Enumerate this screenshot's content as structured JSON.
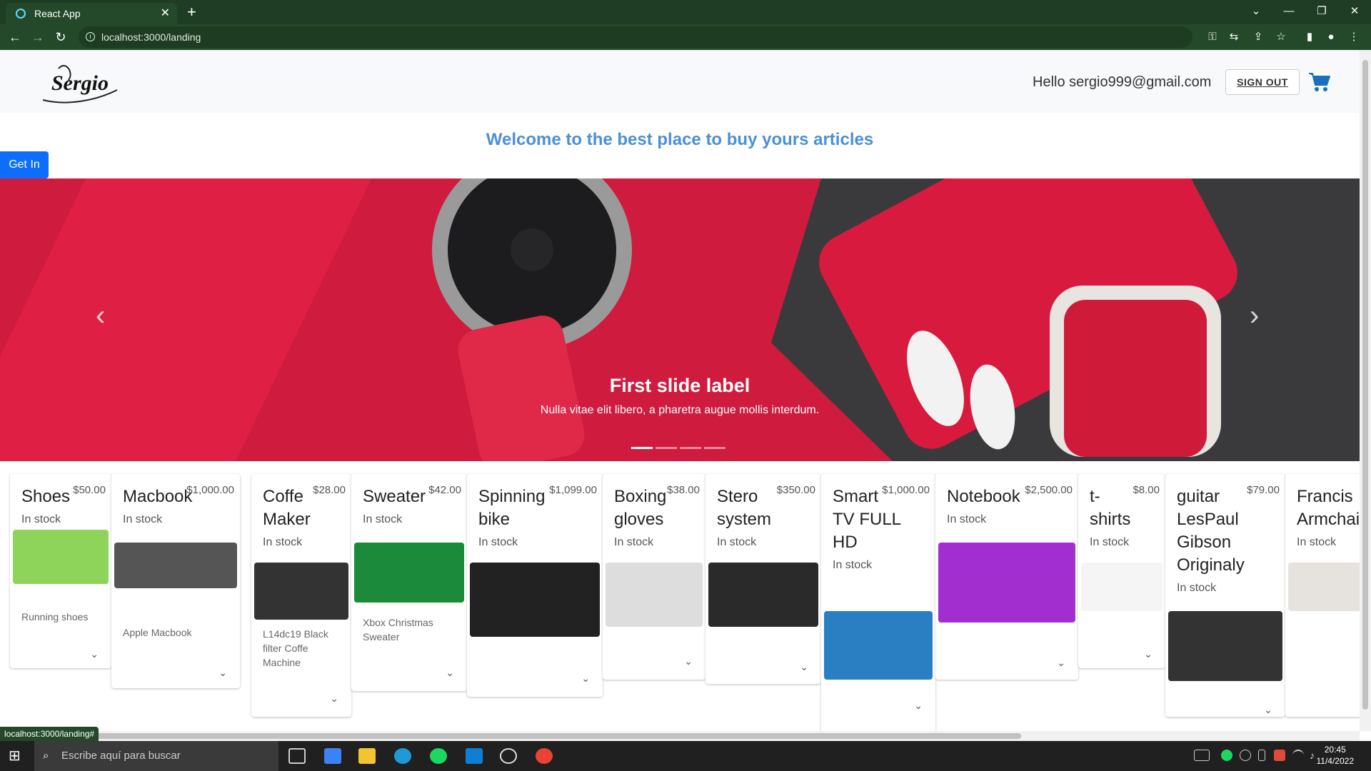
{
  "browser": {
    "tab_title": "React App",
    "tab_close": "✕",
    "new_tab": "+",
    "url": "localhost:3000/landing",
    "status_url": "localhost:3000/landing#"
  },
  "header": {
    "logo_text": "Sergio",
    "greeting": "Hello sergio999@gmail.com",
    "sign_out": "SIGN OUT"
  },
  "welcome": "Welcome to the best place to buy yours articles",
  "get_in": "Get In",
  "carousel": {
    "caption_title": "First slide label",
    "caption_text": "Nulla vitae elit libero, a pharetra augue mollis interdum.",
    "prev": "‹",
    "next": "›",
    "indicator_count": 4,
    "active_index": 0
  },
  "products": [
    {
      "name": "Shoes",
      "price": "$50.00",
      "stock": "In stock",
      "desc": "Running shoes"
    },
    {
      "name": "Macbook",
      "price": "$1,000.00",
      "stock": "In stock",
      "desc": "Apple Macbook"
    },
    {
      "name": "Coffe Maker",
      "price": "$28.00",
      "stock": "In stock",
      "desc": "L14dc19 Black filter Coffe Machine"
    },
    {
      "name": "Sweater",
      "price": "$42.00",
      "stock": "In stock",
      "desc": "Xbox Christmas Sweater"
    },
    {
      "name": "Spinning bike",
      "price": "$1,099.00",
      "stock": "In stock",
      "desc": ""
    },
    {
      "name": "Boxing gloves",
      "price": "$38.00",
      "stock": "In stock",
      "desc": ""
    },
    {
      "name": "Stero system",
      "price": "$350.00",
      "stock": "In stock",
      "desc": ""
    },
    {
      "name": "Smart TV FULL HD",
      "price": "$1,000.00",
      "stock": "In stock",
      "desc": ""
    },
    {
      "name": "Notebook",
      "price": "$2,500.00",
      "stock": "In stock",
      "desc": ""
    },
    {
      "name": "t-shirts",
      "price": "$8.00",
      "stock": "In stock",
      "desc": ""
    },
    {
      "name": "guitar LesPaul Gibson Originaly",
      "price": "$79.00",
      "stock": "In stock",
      "desc": ""
    },
    {
      "name": "Francis Armchair",
      "price": "",
      "stock": "In stock",
      "desc": ""
    }
  ],
  "taskbar": {
    "search_placeholder": "Escribe aquí para buscar",
    "time": "20:45",
    "date": "11/4/2022"
  },
  "colors": {
    "accent": "#0d6efd",
    "welcome": "#4a90d6",
    "browser_frame": "#24492a",
    "carousel_bg": "#d31c3e"
  }
}
